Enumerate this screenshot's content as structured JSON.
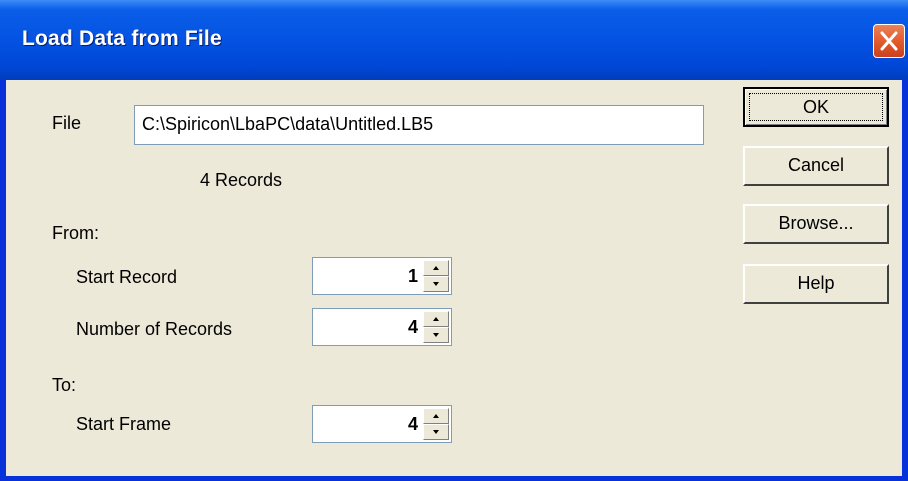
{
  "dialog": {
    "title": "Load Data from File"
  },
  "icons": {
    "close": "close-icon",
    "spin_up": "spin-up-arrow-icon",
    "spin_down": "spin-down-arrow-icon"
  },
  "colors": {
    "titlebar": "#0054e3",
    "close_button": "#e35c2e",
    "dialog_background": "#ece9d8"
  },
  "file": {
    "label": "File",
    "value": "C:\\Spiricon\\LbaPC\\data\\Untitled.LB5",
    "records_info": "4 Records"
  },
  "from": {
    "heading": "From:",
    "start_record_label": "Start Record",
    "start_record_value": "1",
    "number_of_records_label": "Number of Records",
    "number_of_records_value": "4"
  },
  "to": {
    "heading": "To:",
    "start_frame_label": "Start Frame",
    "start_frame_value": "4"
  },
  "buttons": {
    "ok": "OK",
    "cancel": "Cancel",
    "browse": "Browse...",
    "help": "Help"
  }
}
